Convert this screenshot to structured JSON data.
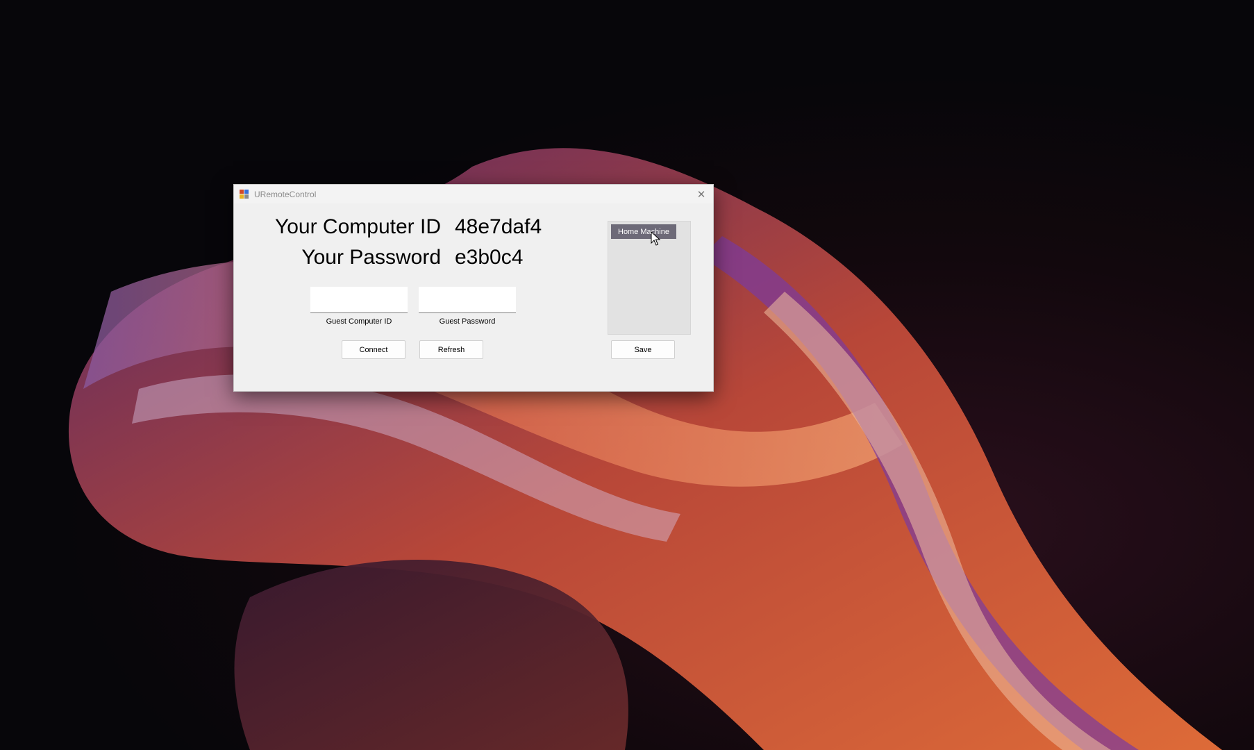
{
  "window": {
    "title": "URemoteControl",
    "close_glyph": "✕"
  },
  "identity": {
    "computer_id_label": "Your Computer ID",
    "computer_id_value": "48e7daf4",
    "password_label": "Your Password",
    "password_value": "e3b0c4"
  },
  "guest": {
    "computer_id_value": "",
    "computer_id_caption": "Guest Computer ID",
    "password_value": "",
    "password_caption": "Guest Password"
  },
  "buttons": {
    "connect": "Connect",
    "refresh": "Refresh",
    "save": "Save"
  },
  "saved_machines": {
    "items": [
      {
        "label": "Home Machine",
        "selected": true
      }
    ]
  },
  "icons": {
    "app": "uremotecontrol-app-icon",
    "close": "close-icon",
    "cursor": "mouse-pointer-icon"
  }
}
